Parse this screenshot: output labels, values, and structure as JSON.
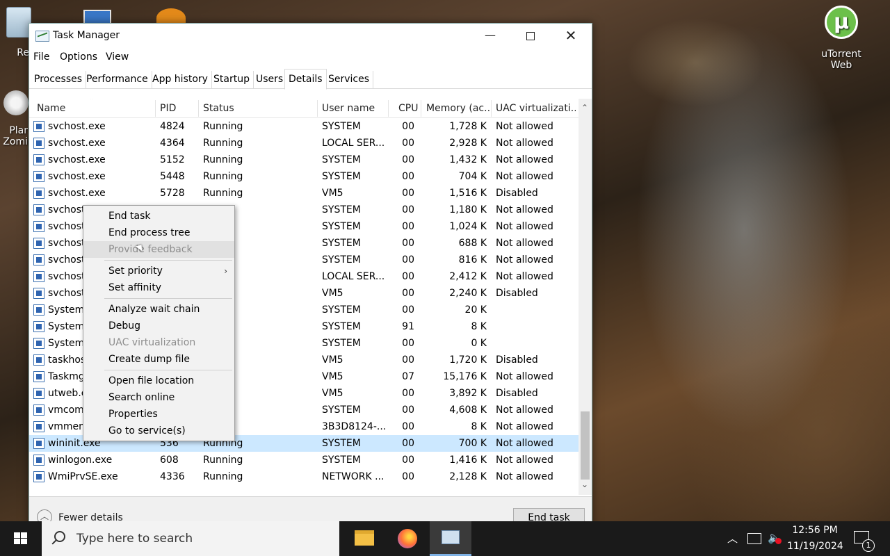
{
  "desktop": {
    "icons": [
      {
        "label": "uTorrent Web",
        "glyph": "µ"
      },
      {
        "label": "Recy"
      },
      {
        "label": "Plar Zomi"
      }
    ]
  },
  "window": {
    "title": "Task Manager",
    "controls": {
      "minimize": "—",
      "close": "✕"
    }
  },
  "menu": [
    "File",
    "Options",
    "View"
  ],
  "tabs": [
    {
      "label": "Processes"
    },
    {
      "label": "Performance"
    },
    {
      "label": "App history"
    },
    {
      "label": "Startup"
    },
    {
      "label": "Users"
    },
    {
      "label": "Details",
      "active": true
    },
    {
      "label": "Services"
    }
  ],
  "table": {
    "columns": [
      "Name",
      "PID",
      "Status",
      "User name",
      "CPU",
      "Memory (ac...",
      "UAC virtualizati..."
    ],
    "rows": [
      {
        "name": "svchost.exe",
        "pid": "4824",
        "status": "Running",
        "user": "SYSTEM",
        "cpu": "00",
        "mem": "1,728 K",
        "uac": "Not allowed"
      },
      {
        "name": "svchost.exe",
        "pid": "4364",
        "status": "Running",
        "user": "LOCAL SER...",
        "cpu": "00",
        "mem": "2,928 K",
        "uac": "Not allowed"
      },
      {
        "name": "svchost.exe",
        "pid": "5152",
        "status": "Running",
        "user": "SYSTEM",
        "cpu": "00",
        "mem": "1,432 K",
        "uac": "Not allowed"
      },
      {
        "name": "svchost.exe",
        "pid": "5448",
        "status": "Running",
        "user": "SYSTEM",
        "cpu": "00",
        "mem": "704 K",
        "uac": "Not allowed"
      },
      {
        "name": "svchost.exe",
        "pid": "5728",
        "status": "Running",
        "user": "VM5",
        "cpu": "00",
        "mem": "1,516 K",
        "uac": "Disabled"
      },
      {
        "name": "svchost.",
        "pid": "",
        "status": "g",
        "user": "SYSTEM",
        "cpu": "00",
        "mem": "1,180 K",
        "uac": "Not allowed"
      },
      {
        "name": "svchost.",
        "pid": "",
        "status": "g",
        "user": "SYSTEM",
        "cpu": "00",
        "mem": "1,024 K",
        "uac": "Not allowed"
      },
      {
        "name": "svchost.",
        "pid": "",
        "status": "g",
        "user": "SYSTEM",
        "cpu": "00",
        "mem": "688 K",
        "uac": "Not allowed"
      },
      {
        "name": "svchost.",
        "pid": "",
        "status": "g",
        "user": "SYSTEM",
        "cpu": "00",
        "mem": "816 K",
        "uac": "Not allowed"
      },
      {
        "name": "svchost.",
        "pid": "",
        "status": "g",
        "user": "LOCAL SER...",
        "cpu": "00",
        "mem": "2,412 K",
        "uac": "Not allowed"
      },
      {
        "name": "svchost.",
        "pid": "",
        "status": "g",
        "user": "VM5",
        "cpu": "00",
        "mem": "2,240 K",
        "uac": "Disabled"
      },
      {
        "name": "System",
        "pid": "",
        "status": "g",
        "user": "SYSTEM",
        "cpu": "00",
        "mem": "20 K",
        "uac": ""
      },
      {
        "name": "System",
        "pid": "",
        "status": "g",
        "user": "SYSTEM",
        "cpu": "91",
        "mem": "8 K",
        "uac": ""
      },
      {
        "name": "System",
        "pid": "",
        "status": "g",
        "user": "SYSTEM",
        "cpu": "00",
        "mem": "0 K",
        "uac": ""
      },
      {
        "name": "taskhost",
        "pid": "",
        "status": "g",
        "user": "VM5",
        "cpu": "00",
        "mem": "1,720 K",
        "uac": "Disabled"
      },
      {
        "name": "Taskmgr",
        "pid": "",
        "status": "g",
        "user": "VM5",
        "cpu": "07",
        "mem": "15,176 K",
        "uac": "Not allowed"
      },
      {
        "name": "utweb.e",
        "pid": "",
        "status": "g",
        "user": "VM5",
        "cpu": "00",
        "mem": "3,892 K",
        "uac": "Disabled"
      },
      {
        "name": "vmcomp",
        "pid": "",
        "status": "g",
        "user": "SYSTEM",
        "cpu": "00",
        "mem": "4,608 K",
        "uac": "Not allowed"
      },
      {
        "name": "vmmem",
        "pid": "",
        "status": "ded",
        "user": "3B3D8124-...",
        "cpu": "00",
        "mem": "8 K",
        "uac": "Not allowed"
      },
      {
        "name": "wininit.exe",
        "pid": "536",
        "status": "Running",
        "user": "SYSTEM",
        "cpu": "00",
        "mem": "700 K",
        "uac": "Not allowed",
        "selected": true
      },
      {
        "name": "winlogon.exe",
        "pid": "608",
        "status": "Running",
        "user": "SYSTEM",
        "cpu": "00",
        "mem": "1,416 K",
        "uac": "Not allowed"
      },
      {
        "name": "WmiPrvSE.exe",
        "pid": "4336",
        "status": "Running",
        "user": "NETWORK ...",
        "cpu": "00",
        "mem": "2,128 K",
        "uac": "Not allowed"
      }
    ]
  },
  "footer": {
    "fewer_details": "Fewer details",
    "end_task": "End task"
  },
  "context_menu": {
    "items": [
      {
        "label": "End task"
      },
      {
        "label": "End process tree"
      },
      {
        "label": "Provide feedback",
        "disabled": true,
        "hover": true
      },
      {
        "separator": true
      },
      {
        "label": "Set priority",
        "submenu": true
      },
      {
        "label": "Set affinity"
      },
      {
        "separator": true
      },
      {
        "label": "Analyze wait chain"
      },
      {
        "label": "Debug"
      },
      {
        "label": "UAC virtualization",
        "disabled": true
      },
      {
        "label": "Create dump file"
      },
      {
        "separator": true
      },
      {
        "label": "Open file location"
      },
      {
        "label": "Search online"
      },
      {
        "label": "Properties"
      },
      {
        "label": "Go to service(s)"
      }
    ]
  },
  "taskbar": {
    "search_placeholder": "Type here to search",
    "clock_time": "12:56 PM",
    "clock_date": "11/19/2024",
    "notification_count": "1"
  }
}
